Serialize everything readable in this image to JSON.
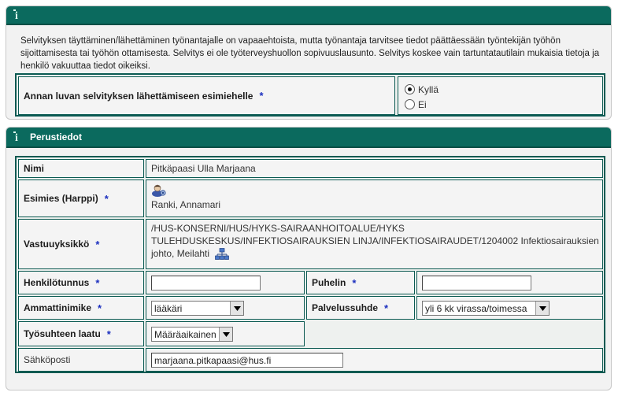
{
  "consent_panel": {
    "intro": "Selvityksen täyttäminen/lähettäminen työnantajalle on vapaaehtoista, mutta työnantaja tarvitsee tiedot päättäessään työntekijän työhön sijoittamisesta tai työhön ottamisesta. Selvitys ei ole työterveyshuollon sopivuuslausunto. Selvitys koskee vain tartuntatautilain mukaisia tietoja ja henkilö vakuuttaa tiedot oikeiksi.",
    "question": "Annan luvan selvityksen lähettämiseen esimiehelle",
    "required_mark": "*",
    "options": [
      {
        "label": "Kyllä",
        "selected": true
      },
      {
        "label": "Ei",
        "selected": false
      }
    ]
  },
  "basic_panel": {
    "title": "Perustiedot",
    "name_label": "Nimi",
    "name_value": "Pitkäpaasi Ulla Marjaana",
    "supervisor_label": "Esimies (Harppi)",
    "supervisor_value": "Ranki, Annamari",
    "unit_label": "Vastuuyksikkö",
    "unit_value": "/HUS-KONSERNI/HUS/HYKS-SAIRAANHOITOALUE/HYKS TULEHDUSKESKUS/INFEKTIOSAIRAUKSIEN LINJA/INFEKTIOSAIRAUDET/1204002 Infektiosairauksien johto, Meilahti",
    "ssn_label": "Henkilötunnus",
    "ssn_value": "",
    "phone_label": "Puhelin",
    "phone_value": "",
    "title_label": "Ammattinimike",
    "title_value": "lääkäri",
    "employment_label": "Palvelussuhde",
    "employment_value": "yli 6 kk virassa/toimessa",
    "contract_label": "Työsuhteen laatu",
    "contract_value": "Määräaikainen",
    "email_label": "Sähköposti",
    "email_value": "marjaana.pitkapaasi@hus.fi",
    "required_mark": "*"
  },
  "colors": {
    "header": "#0b6a5e",
    "border": "#0b5a52",
    "required": "#1b2fbf"
  },
  "icons": [
    "info-icon",
    "person-icon",
    "org-chart-icon",
    "chevron-down-icon"
  ]
}
